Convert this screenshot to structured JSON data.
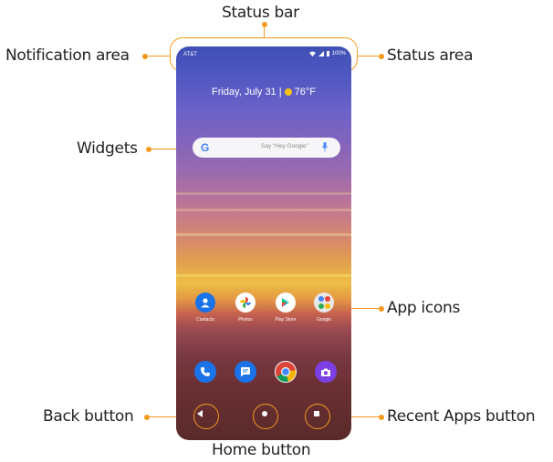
{
  "callouts": {
    "status_bar": "Status bar",
    "notification_area": "Notification area",
    "status_area": "Status area",
    "widgets": "Widgets",
    "app_icons": "App icons",
    "back_button": "Back button",
    "home_button": "Home button",
    "recent_apps_button": "Recent Apps button"
  },
  "phone": {
    "carrier": "AT&T",
    "battery": "100%",
    "date_widget": "Friday, July 31 | ",
    "temperature": "76°F",
    "search_hint": "Say “Hey Google”",
    "apps": [
      {
        "label": "Contacts",
        "icon": "contacts-icon",
        "color": "#1a73e8"
      },
      {
        "label": "Photos",
        "icon": "photos-icon",
        "color": "#ffffff"
      },
      {
        "label": "Play Store",
        "icon": "play-store-icon",
        "color": "#ffffff"
      },
      {
        "label": "Google",
        "icon": "google-folder-icon",
        "color": "#e8e8e8"
      }
    ],
    "dock": [
      {
        "icon": "phone-icon",
        "color": "#1a73e8"
      },
      {
        "icon": "messages-icon",
        "color": "#1a73e8"
      },
      {
        "icon": "chrome-icon",
        "color": "#ffffff"
      },
      {
        "icon": "camera-icon",
        "color": "#7b3fe4"
      }
    ]
  },
  "colors": {
    "accent": "#f39a1f",
    "label_text": "#231f20"
  }
}
